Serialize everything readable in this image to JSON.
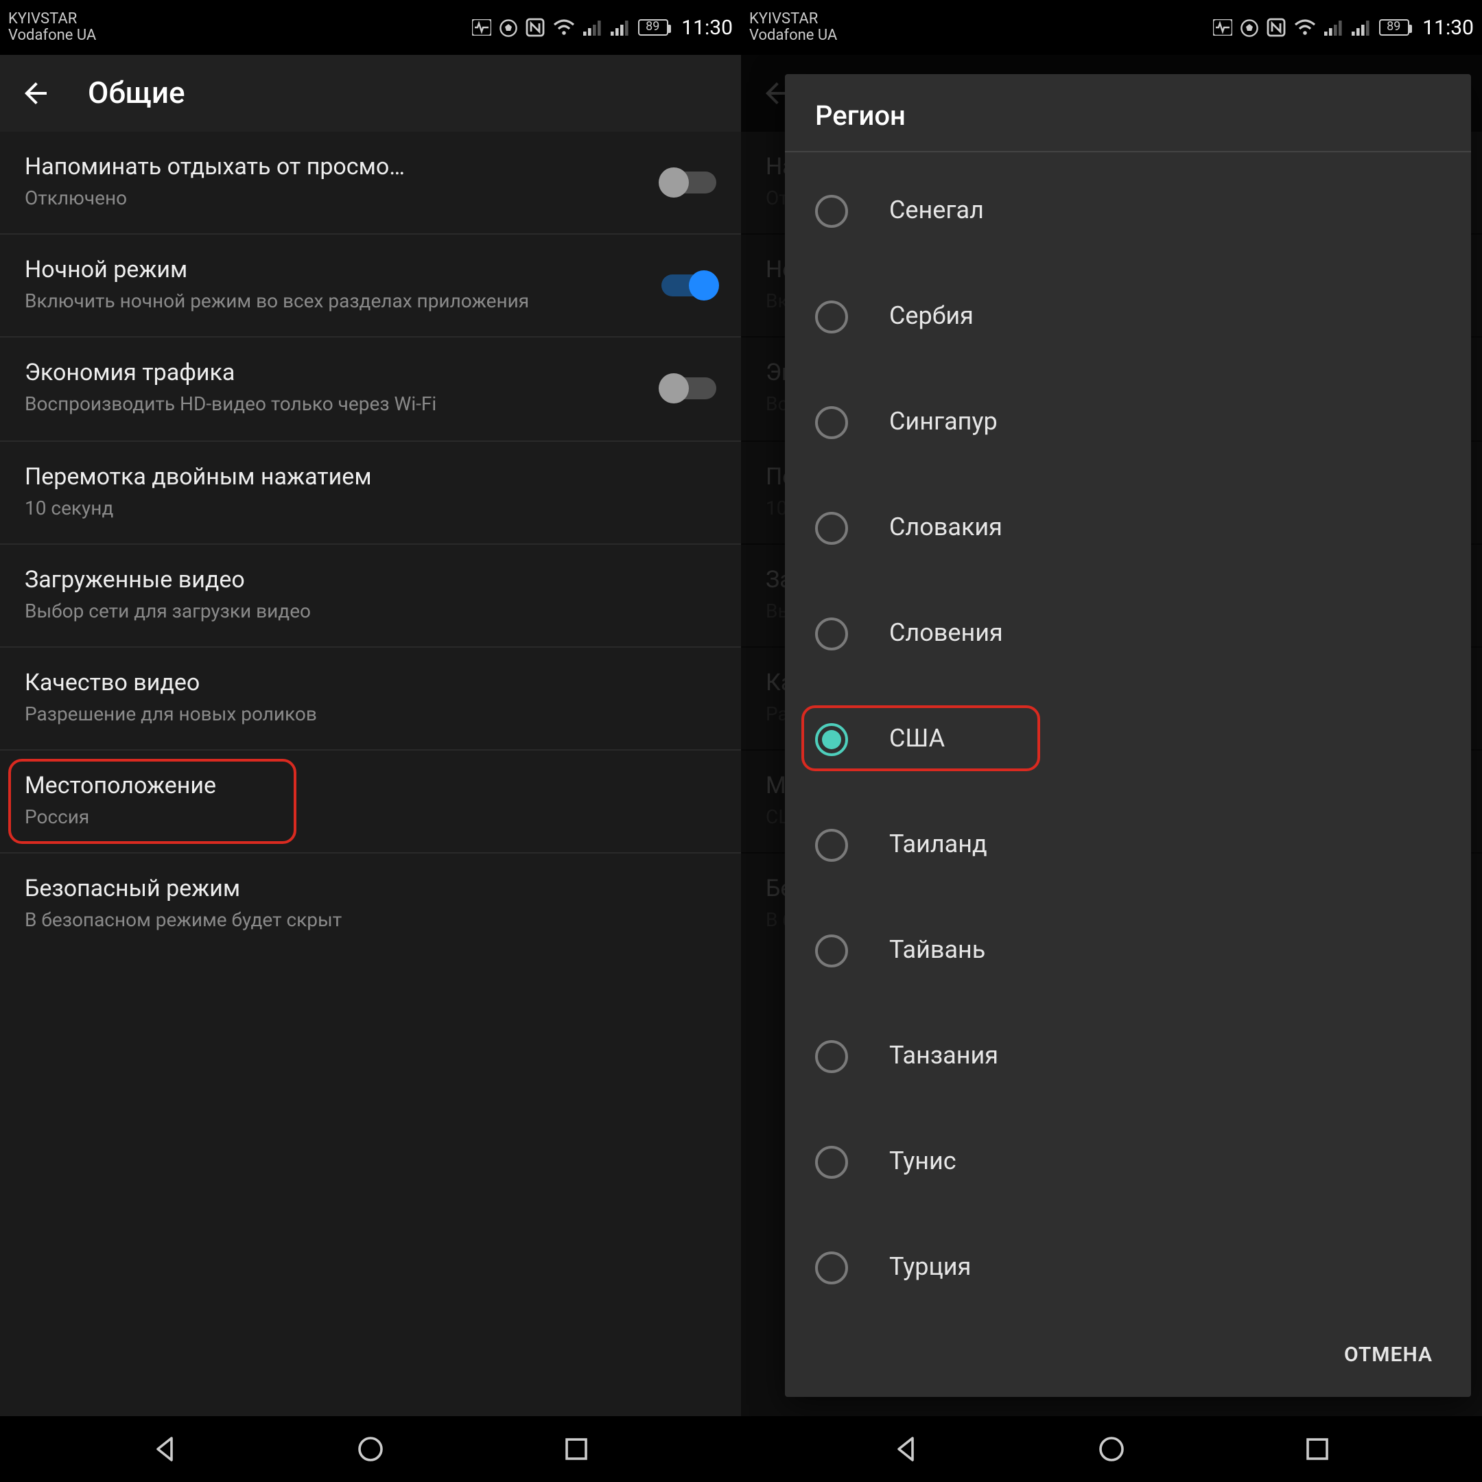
{
  "statusbar": {
    "carrier1": "KYIVSTAR",
    "carrier2": "Vodafone UA",
    "battery": "89",
    "time": "11:30"
  },
  "appbar": {
    "title": "Общие"
  },
  "settings": [
    {
      "title": "Напоминать отдыхать от просмо…",
      "sub": "Отключено",
      "toggle": "off"
    },
    {
      "title": "Ночной режим",
      "sub": "Включить ночной режим во всех разделах приложения",
      "toggle": "on"
    },
    {
      "title": "Экономия трафика",
      "sub": "Воспроизводить HD-видео только через Wi-Fi",
      "toggle": "off"
    },
    {
      "title": "Перемотка двойным нажатием",
      "sub": "10 секунд"
    },
    {
      "title": "Загруженные видео",
      "sub": "Выбор сети для загрузки видео"
    },
    {
      "title": "Качество видео",
      "sub": "Разрешение для новых роликов"
    },
    {
      "title": "Местоположение",
      "sub": "Россия"
    },
    {
      "title": "Безопасный режим",
      "sub": "В безопасном режиме будет скрыт"
    }
  ],
  "dialog": {
    "title": "Регион",
    "options": [
      {
        "label": "Сенегал",
        "checked": false
      },
      {
        "label": "Сербия",
        "checked": false
      },
      {
        "label": "Сингапур",
        "checked": false
      },
      {
        "label": "Словакия",
        "checked": false
      },
      {
        "label": "Словения",
        "checked": false
      },
      {
        "label": "США",
        "checked": true
      },
      {
        "label": "Таиланд",
        "checked": false
      },
      {
        "label": "Тайвань",
        "checked": false
      },
      {
        "label": "Танзания",
        "checked": false
      },
      {
        "label": "Тунис",
        "checked": false
      },
      {
        "label": "Турция",
        "checked": false
      }
    ],
    "cancel": "ОТМЕНА"
  },
  "phone2_location_sub": "США"
}
